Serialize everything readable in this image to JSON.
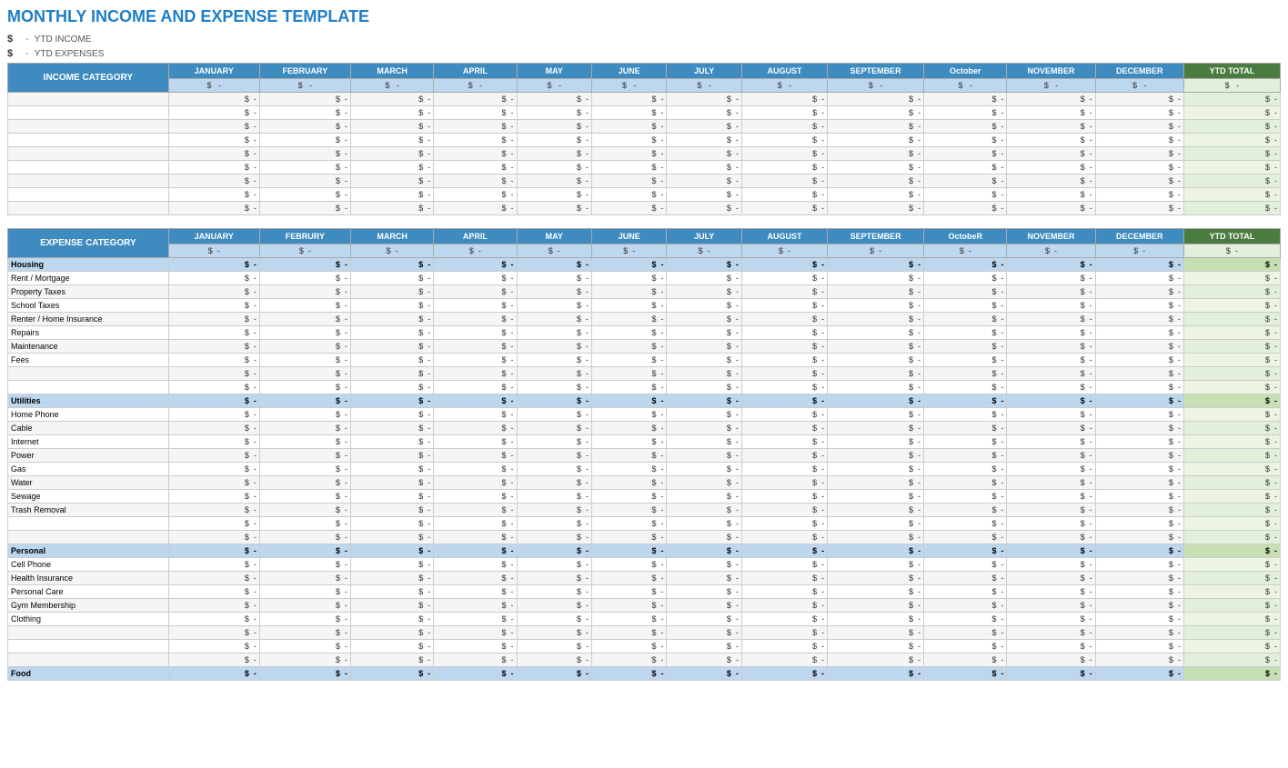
{
  "title": "MONTHLY INCOME AND EXPENSE TEMPLATE",
  "ytd": {
    "income_label": "YTD INCOME",
    "expense_label": "YTD EXPENSES",
    "dollar": "$",
    "dash": "-"
  },
  "months": [
    "JANUARY",
    "FEBRUARY",
    "MARCH",
    "APRIL",
    "MAY",
    "JUNE",
    "JULY",
    "AUGUST",
    "SEPTEMBER",
    "OCTOBER",
    "NOVEMBER",
    "DECEMBER"
  ],
  "months_expense": [
    "JANUARY",
    "FEBRURY",
    "MARCH",
    "APRIL",
    "MAY",
    "JUNE",
    "JULY",
    "AUGUST",
    "SEPTEMBER",
    "OCTOBER",
    "NOVEMBER",
    "DECEMBER"
  ],
  "ytd_label": "YTD TOTAL",
  "income_section": {
    "header": "INCOME CATEGORY",
    "rows": [
      {
        "label": "",
        "values": [
          "$  -",
          "$  -",
          "$  -",
          "$  -",
          "$  -",
          "$  -",
          "$  -",
          "$  -",
          "$  -",
          "$  -",
          "$  -",
          "$  -",
          "$  -"
        ]
      },
      {
        "label": "",
        "values": [
          "$  -",
          "$  -",
          "$  -",
          "$  -",
          "$  -",
          "$  -",
          "$  -",
          "$  -",
          "$  -",
          "$  -",
          "$  -",
          "$  -",
          "$  -"
        ]
      },
      {
        "label": "",
        "values": [
          "$  -",
          "$  -",
          "$  -",
          "$  -",
          "$  -",
          "$  -",
          "$  -",
          "$  -",
          "$  -",
          "$  -",
          "$  -",
          "$  -",
          "$  -"
        ]
      },
      {
        "label": "",
        "values": [
          "$  -",
          "$  -",
          "$  -",
          "$  -",
          "$  -",
          "$  -",
          "$  -",
          "$  -",
          "$  -",
          "$  -",
          "$  -",
          "$  -",
          "$  -"
        ]
      },
      {
        "label": "",
        "values": [
          "$  -",
          "$  -",
          "$  -",
          "$  -",
          "$  -",
          "$  -",
          "$  -",
          "$  -",
          "$  -",
          "$  -",
          "$  -",
          "$  -",
          "$  -"
        ]
      },
      {
        "label": "",
        "values": [
          "$  -",
          "$  -",
          "$  -",
          "$  -",
          "$  -",
          "$  -",
          "$  -",
          "$  -",
          "$  -",
          "$  -",
          "$  -",
          "$  -",
          "$  -"
        ]
      },
      {
        "label": "",
        "values": [
          "$  -",
          "$  -",
          "$  -",
          "$  -",
          "$  -",
          "$  -",
          "$  -",
          "$  -",
          "$  -",
          "$  -",
          "$  -",
          "$  -",
          "$  -"
        ]
      },
      {
        "label": "",
        "values": [
          "$  -",
          "$  -",
          "$  -",
          "$  -",
          "$  -",
          "$  -",
          "$  -",
          "$  -",
          "$  -",
          "$  -",
          "$  -",
          "$  -",
          "$  -"
        ]
      },
      {
        "label": "",
        "values": [
          "$  -",
          "$  -",
          "$  -",
          "$  -",
          "$  -",
          "$  -",
          "$  -",
          "$  -",
          "$  -",
          "$  -",
          "$  -",
          "$  -",
          "$  -"
        ]
      }
    ]
  },
  "expense_section": {
    "header": "EXPENSE CATEGORY",
    "categories": [
      {
        "name": "Housing",
        "rows": [
          {
            "label": "Rent / Mortgage"
          },
          {
            "label": "Property Taxes"
          },
          {
            "label": "School Taxes"
          },
          {
            "label": "Renter / Home Insurance"
          },
          {
            "label": "Repairs"
          },
          {
            "label": "Maintenance"
          },
          {
            "label": "Fees"
          },
          {
            "label": ""
          },
          {
            "label": ""
          }
        ]
      },
      {
        "name": "Utilities",
        "rows": [
          {
            "label": "Home Phone"
          },
          {
            "label": "Cable"
          },
          {
            "label": "Internet"
          },
          {
            "label": "Power"
          },
          {
            "label": "Gas"
          },
          {
            "label": "Water"
          },
          {
            "label": "Sewage"
          },
          {
            "label": "Trash Removal"
          },
          {
            "label": ""
          },
          {
            "label": ""
          }
        ]
      },
      {
        "name": "Personal",
        "rows": [
          {
            "label": "Cell Phone"
          },
          {
            "label": "Health Insurance"
          },
          {
            "label": "Personal Care"
          },
          {
            "label": "Gym Membership"
          },
          {
            "label": "Clothing"
          },
          {
            "label": ""
          },
          {
            "label": ""
          },
          {
            "label": ""
          }
        ]
      },
      {
        "name": "Food",
        "rows": []
      }
    ]
  }
}
